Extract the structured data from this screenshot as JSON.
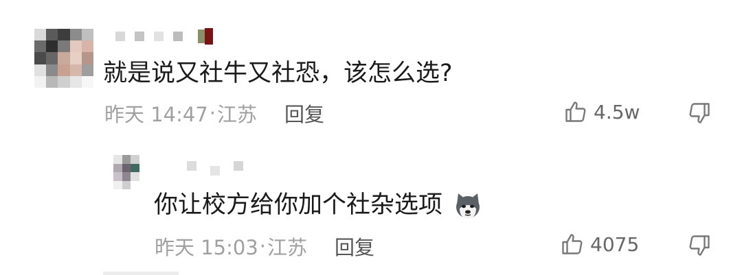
{
  "comments": [
    {
      "text": "就是说又社牛又社恐，该怎么选?",
      "time": "昨天 14:47",
      "location": "江苏",
      "reply_label": "回复",
      "likes": "4.5w"
    },
    {
      "text": "你让校方给你加个社杂选项",
      "emoji": "husky-dog-emoji",
      "time": "昨天 15:03",
      "location": "江苏",
      "reply_label": "回复",
      "likes": "4075"
    }
  ],
  "separator": "·",
  "icons": {
    "like": "thumbs-up-icon",
    "dislike": "thumbs-down-icon"
  }
}
